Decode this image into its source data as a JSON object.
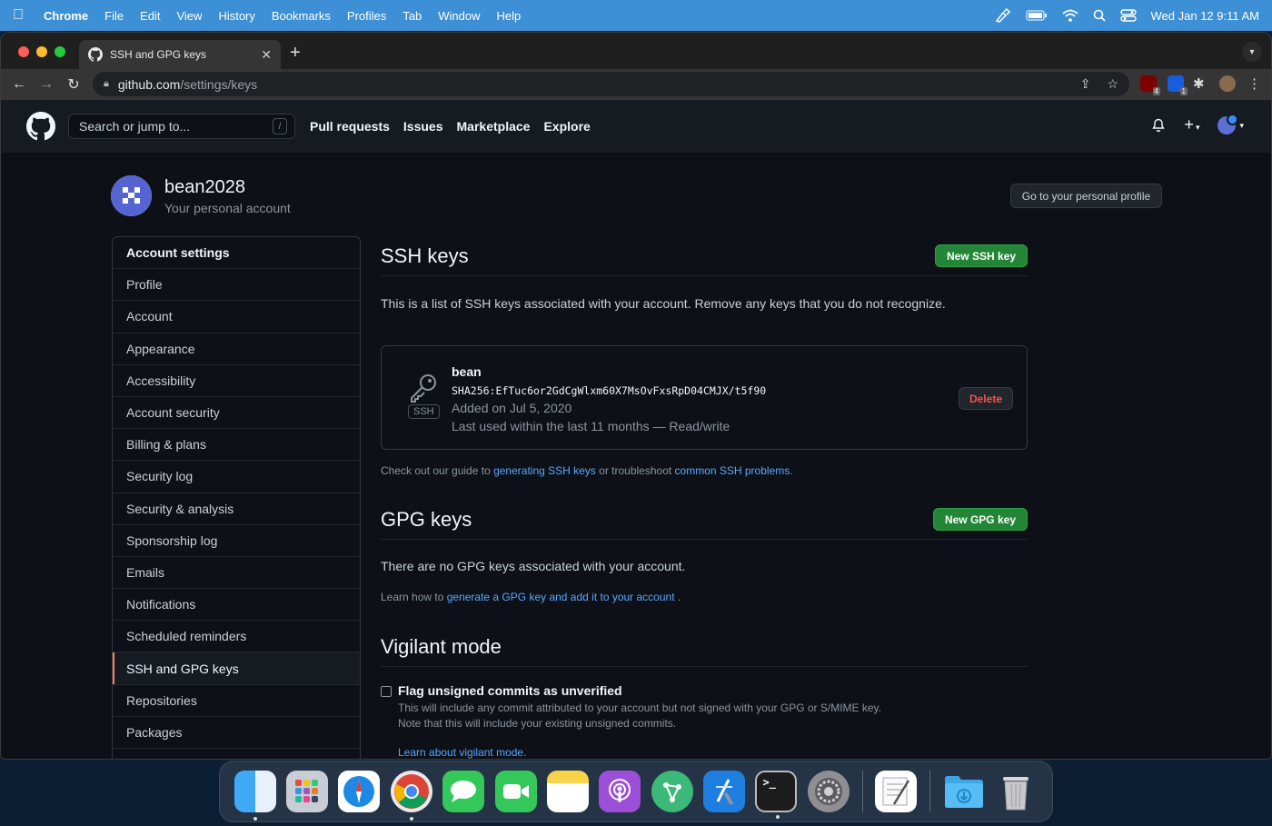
{
  "menubar": {
    "app": "Chrome",
    "items": [
      "File",
      "Edit",
      "View",
      "History",
      "Bookmarks",
      "Profiles",
      "Tab",
      "Window",
      "Help"
    ],
    "datetime": "Wed Jan 12  9:11 AM"
  },
  "browser": {
    "tab_title": "SSH and GPG keys",
    "url_host": "github.com",
    "url_path": "/settings/keys",
    "ext_badges": [
      "4",
      "1"
    ]
  },
  "github": {
    "search_placeholder": "Search or jump to...",
    "search_shortcut": "/",
    "nav": [
      "Pull requests",
      "Issues",
      "Marketplace",
      "Explore"
    ]
  },
  "user": {
    "name": "bean2028",
    "subtitle": "Your personal account",
    "profile_button": "Go to your personal profile"
  },
  "sidebar": {
    "heading": "Account settings",
    "items": [
      "Profile",
      "Account",
      "Appearance",
      "Accessibility",
      "Account security",
      "Billing & plans",
      "Security log",
      "Security & analysis",
      "Sponsorship log",
      "Emails",
      "Notifications",
      "Scheduled reminders",
      "SSH and GPG keys",
      "Repositories",
      "Packages"
    ],
    "active": "SSH and GPG keys"
  },
  "ssh": {
    "title": "SSH keys",
    "new_button": "New SSH key",
    "description": "This is a list of SSH keys associated with your account. Remove any keys that you do not recognize.",
    "key": {
      "badge": "SSH",
      "name": "bean",
      "fingerprint": "SHA256:EfTuc6or2GdCgWlxm60X7MsOvFxsRpD04CMJX/t5f90",
      "added": "Added on Jul 5, 2020",
      "last_used": "Last used within the last 11 months — Read/write",
      "delete_button": "Delete"
    },
    "guide_prefix": "Check out our guide to ",
    "guide_link1": "generating SSH keys",
    "guide_middle": " or troubleshoot ",
    "guide_link2": "common SSH problems",
    "guide_suffix": "."
  },
  "gpg": {
    "title": "GPG keys",
    "new_button": "New GPG key",
    "empty": "There are no GPG keys associated with your account.",
    "learn_prefix": "Learn how to ",
    "learn_link": "generate a GPG key and add it to your account",
    "learn_suffix": " ."
  },
  "vigilant": {
    "title": "Vigilant mode",
    "checkbox_label": "Flag unsigned commits as unverified",
    "checked": false,
    "desc1": "This will include any commit attributed to your account but not signed with your GPG or S/MIME key.",
    "desc2": "Note that this will include your existing unsigned commits.",
    "learn_link": "Learn about vigilant mode."
  },
  "colors": {
    "accent_green": "#238636",
    "link_blue": "#58a6ff",
    "danger_red": "#f85149",
    "active_marker": "#f78166"
  },
  "dock": [
    "finder-icon",
    "launchpad-icon",
    "safari-icon",
    "chrome-icon",
    "messages-icon",
    "facetime-icon",
    "notes-icon",
    "podcasts-icon",
    "gitkraken-icon",
    "xcode-icon",
    "terminal-icon",
    "system-preferences-icon",
    "textedit-icon",
    "downloads-folder-icon",
    "trash-icon"
  ]
}
